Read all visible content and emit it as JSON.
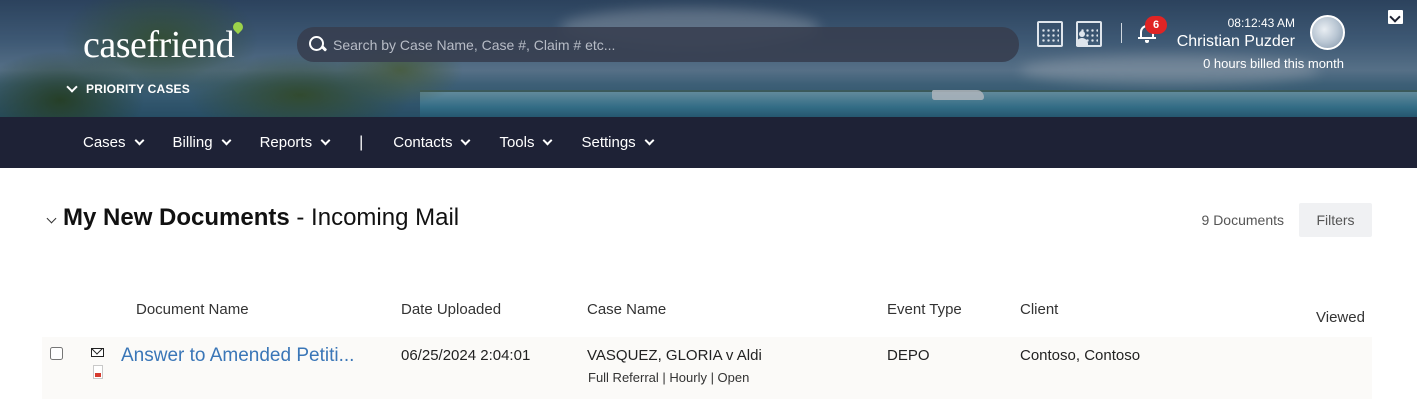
{
  "header": {
    "logo": "casefriend",
    "priority_label": "PRIORITY CASES",
    "search_placeholder": "Search by Case Name, Case #, Claim # etc...",
    "notifications_count": "6",
    "time": "08:12:43 AM",
    "user_name": "Christian Puzder",
    "billed": "0 hours billed this month"
  },
  "nav": {
    "items": [
      "Cases",
      "Billing",
      "Reports",
      "Contacts",
      "Tools",
      "Settings"
    ],
    "separator": "|"
  },
  "section": {
    "title_bold": "My New Documents",
    "title_rest": "- Incoming Mail",
    "count": "9 Documents",
    "filters_label": "Filters"
  },
  "table": {
    "columns": [
      "Document Name",
      "Date Uploaded",
      "Case Name",
      "Event Type",
      "Client",
      "Viewed"
    ],
    "rows": [
      {
        "document_name": "Answer to Amended Petiti...",
        "date_uploaded": "06/25/2024 2:04:01",
        "case_name": "VASQUEZ, GLORIA v Aldi",
        "case_details": "Full Referral | Hourly | Open",
        "event_type": "DEPO",
        "client": "Contoso, Contoso",
        "viewed": ""
      }
    ]
  },
  "colors": {
    "nav_bg": "#1e2236",
    "link": "#3a76b7",
    "badge": "#e02424"
  }
}
